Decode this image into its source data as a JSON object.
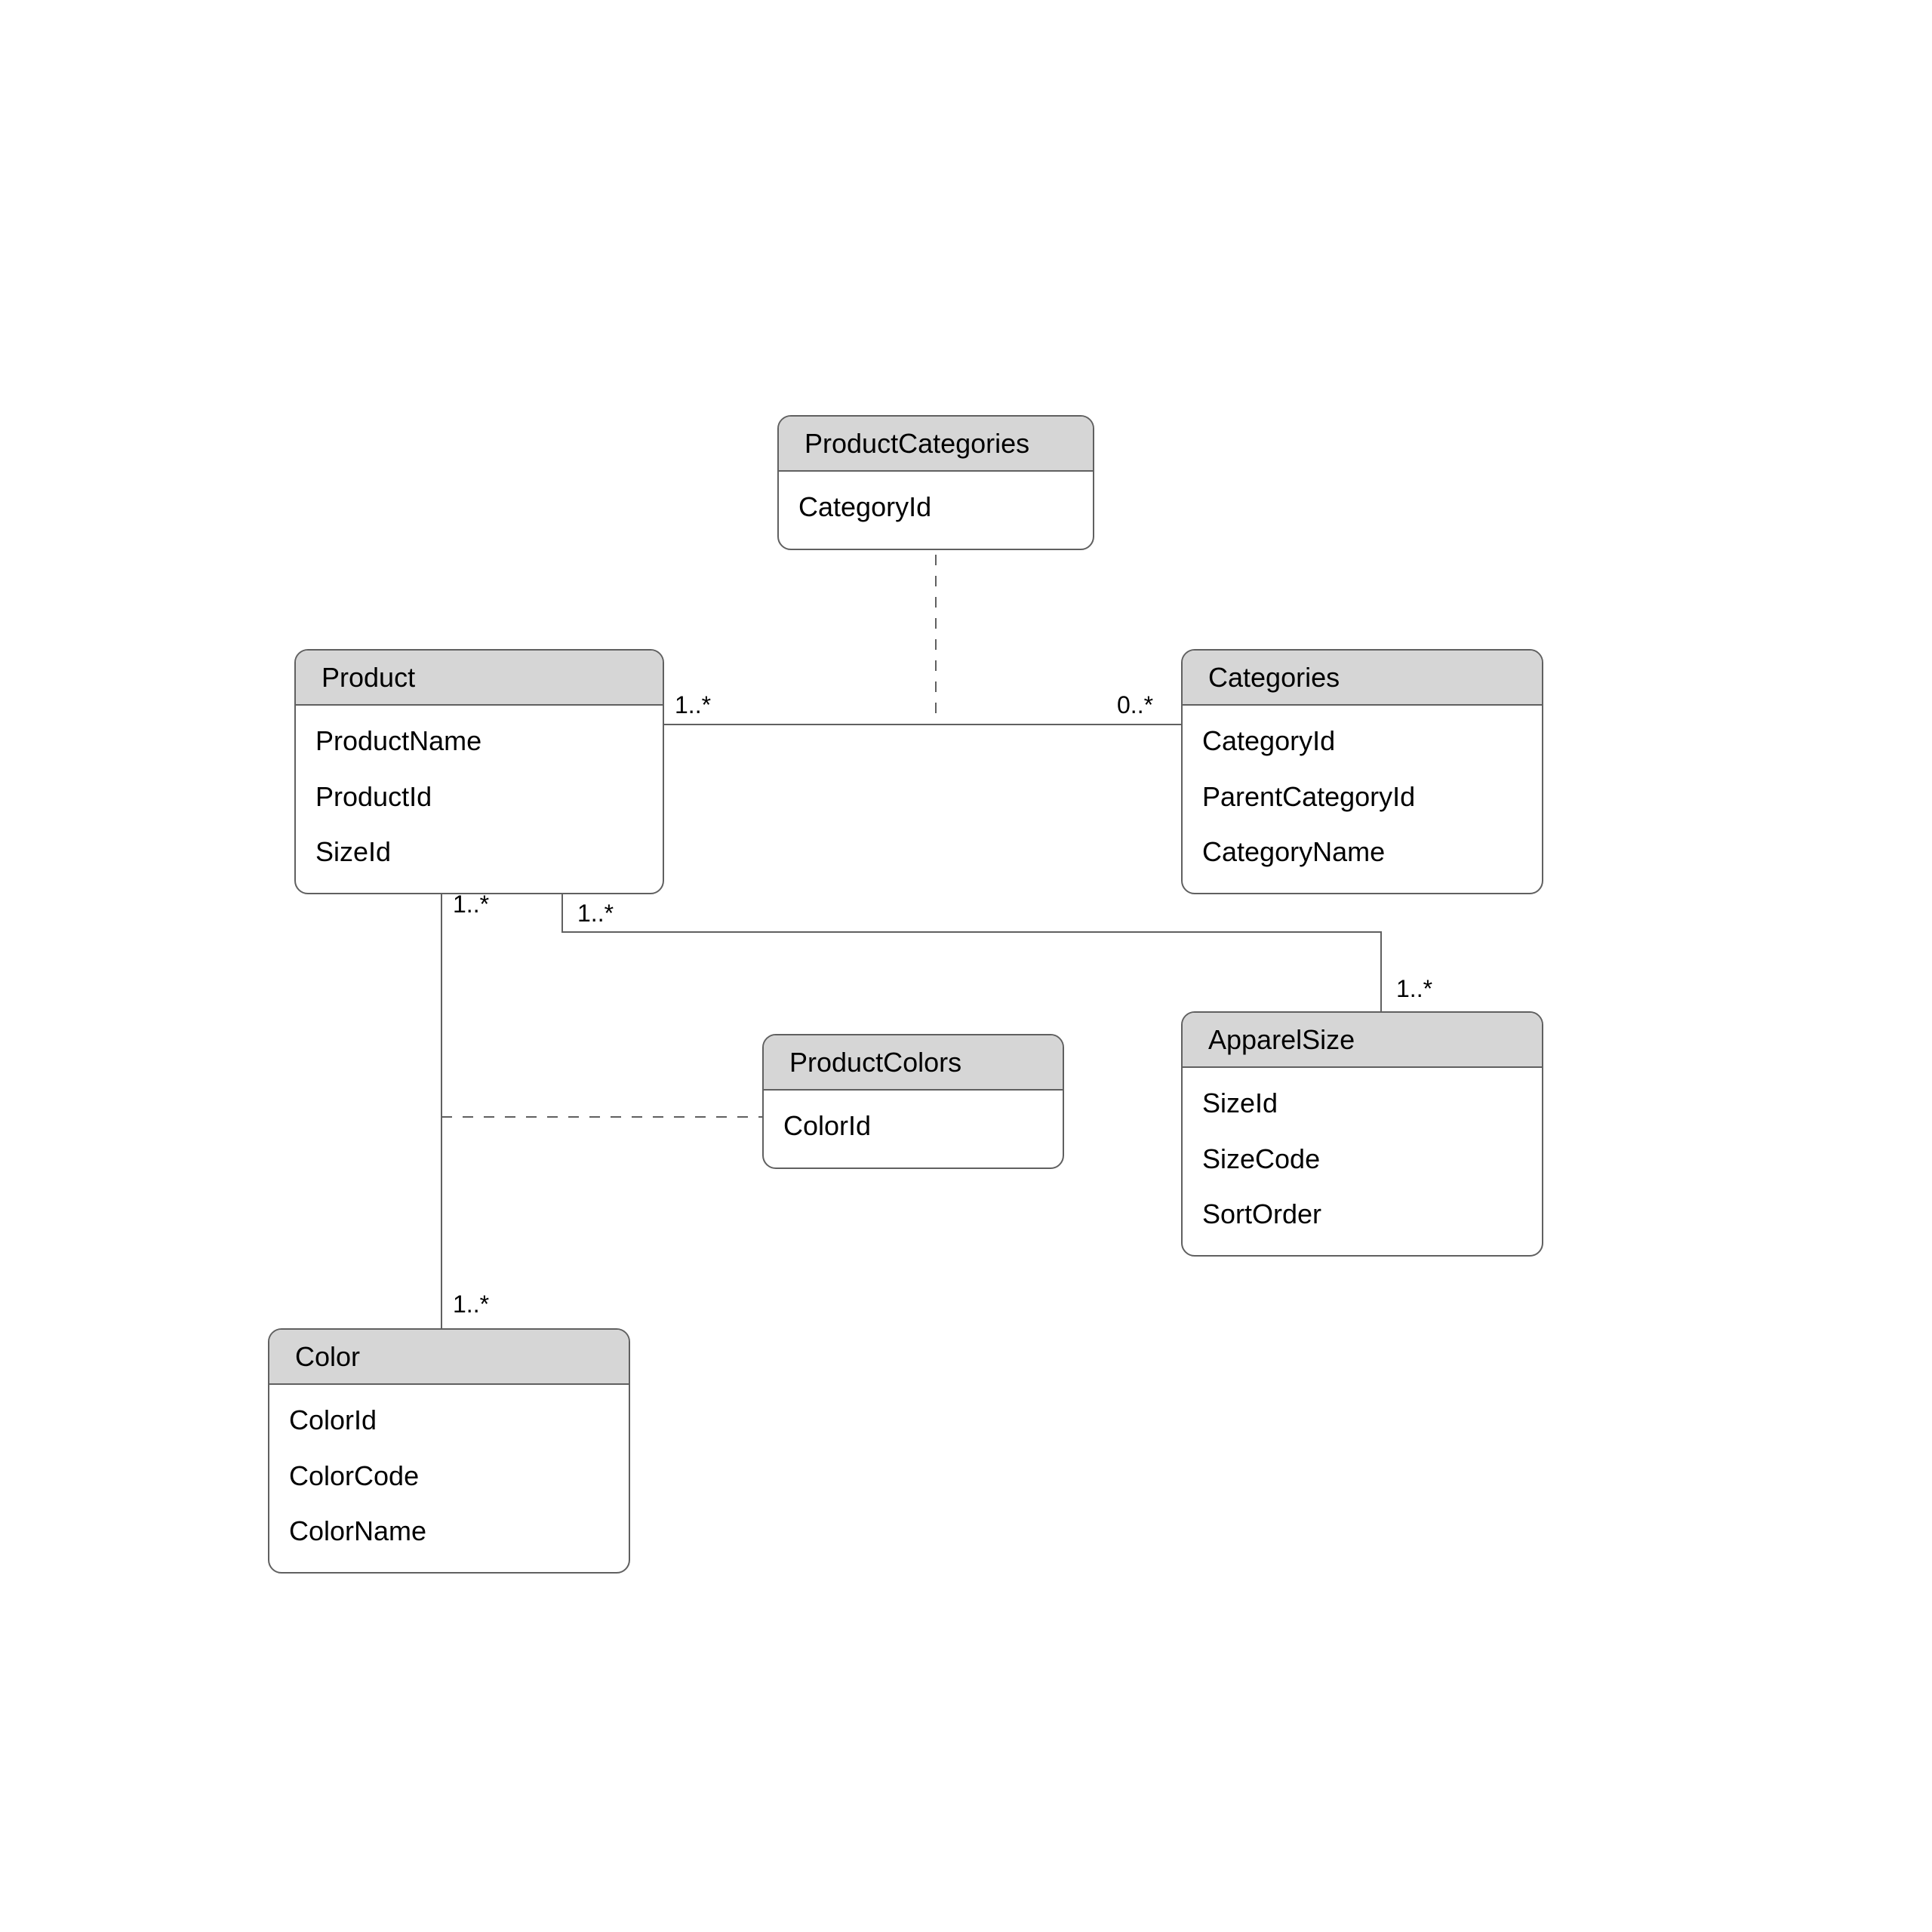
{
  "entities": {
    "productCategories": {
      "title": "ProductCategories",
      "attrs": [
        "CategoryId"
      ]
    },
    "product": {
      "title": "Product",
      "attrs": [
        "ProductName",
        "ProductId",
        "SizeId"
      ]
    },
    "categories": {
      "title": "Categories",
      "attrs": [
        "CategoryId",
        "ParentCategoryId",
        "CategoryName"
      ]
    },
    "productColors": {
      "title": "ProductColors",
      "attrs": [
        "ColorId"
      ]
    },
    "apparelSize": {
      "title": "ApparelSize",
      "attrs": [
        "SizeId",
        "SizeCode",
        "SortOrder"
      ]
    },
    "color": {
      "title": "Color",
      "attrs": [
        "ColorId",
        "ColorCode",
        "ColorName"
      ]
    }
  },
  "multiplicities": {
    "prodCat_left": "1..*",
    "prodCat_right": "0..*",
    "prodColor_top": "1..*",
    "prodColor_bottom": "1..*",
    "prodSize_left": "1..*",
    "prodSize_right": "1..*"
  }
}
